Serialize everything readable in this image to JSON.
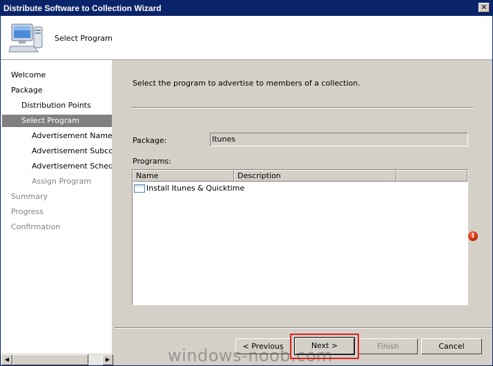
{
  "window": {
    "title": "Distribute Software to Collection Wizard",
    "close_glyph": "✕"
  },
  "header": {
    "title": "Select Program",
    "icon": "computer-icon"
  },
  "nav": {
    "items": [
      {
        "label": "Welcome",
        "state": "normal"
      },
      {
        "label": "Package",
        "state": "normal"
      },
      {
        "label": "Distribution Points",
        "state": "normal"
      },
      {
        "label": "Select Program",
        "state": "selected"
      },
      {
        "label": "Advertisement Name",
        "state": "normal"
      },
      {
        "label": "Advertisement Subcollec",
        "state": "normal"
      },
      {
        "label": "Advertisement Schedule",
        "state": "normal"
      },
      {
        "label": "Assign Program",
        "state": "disabled"
      },
      {
        "label": "Summary",
        "state": "disabled"
      },
      {
        "label": "Progress",
        "state": "disabled"
      },
      {
        "label": "Confirmation",
        "state": "disabled"
      }
    ],
    "scroll_left": "◀",
    "scroll_right": "▶"
  },
  "content": {
    "instruction": "Select the program to advertise to members of a collection.",
    "package_label": "Package:",
    "package_value": "Itunes",
    "programs_label": "Programs:",
    "columns": [
      "Name",
      "Description"
    ],
    "rows": [
      {
        "name": "Install Itunes & Quicktime",
        "description": ""
      }
    ],
    "error_glyph": "!"
  },
  "buttons": {
    "previous": "< Previous",
    "next": "Next >",
    "finish": "Finish",
    "cancel": "Cancel"
  },
  "watermark": "windows-noob.com",
  "colors": {
    "title_bar": "#0a246a",
    "selected_nav": "#808080",
    "highlight": "#e02020",
    "error": "#c02000"
  }
}
